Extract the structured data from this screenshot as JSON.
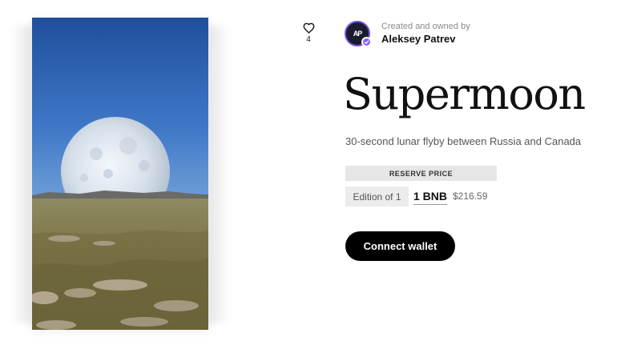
{
  "artwork": {
    "alt": "Moon rising over grassland steppe"
  },
  "likes": {
    "count": "4",
    "icon": "heart-icon"
  },
  "creator": {
    "caption": "Created and owned by",
    "name": "Aleksey Patrev",
    "avatar_initials": "AP",
    "avatar_ring_color": "#7b4fe0",
    "verified_color": "#8a63f5"
  },
  "nft": {
    "title": "Supermoon",
    "description": "30-second lunar flyby between Russia and Canada"
  },
  "pricing": {
    "reserve_label": "RESERVE PRICE",
    "edition": "Edition of 1",
    "price_crypto": "1 BNB",
    "price_fiat": "$216.59"
  },
  "actions": {
    "connect_wallet": "Connect wallet"
  }
}
